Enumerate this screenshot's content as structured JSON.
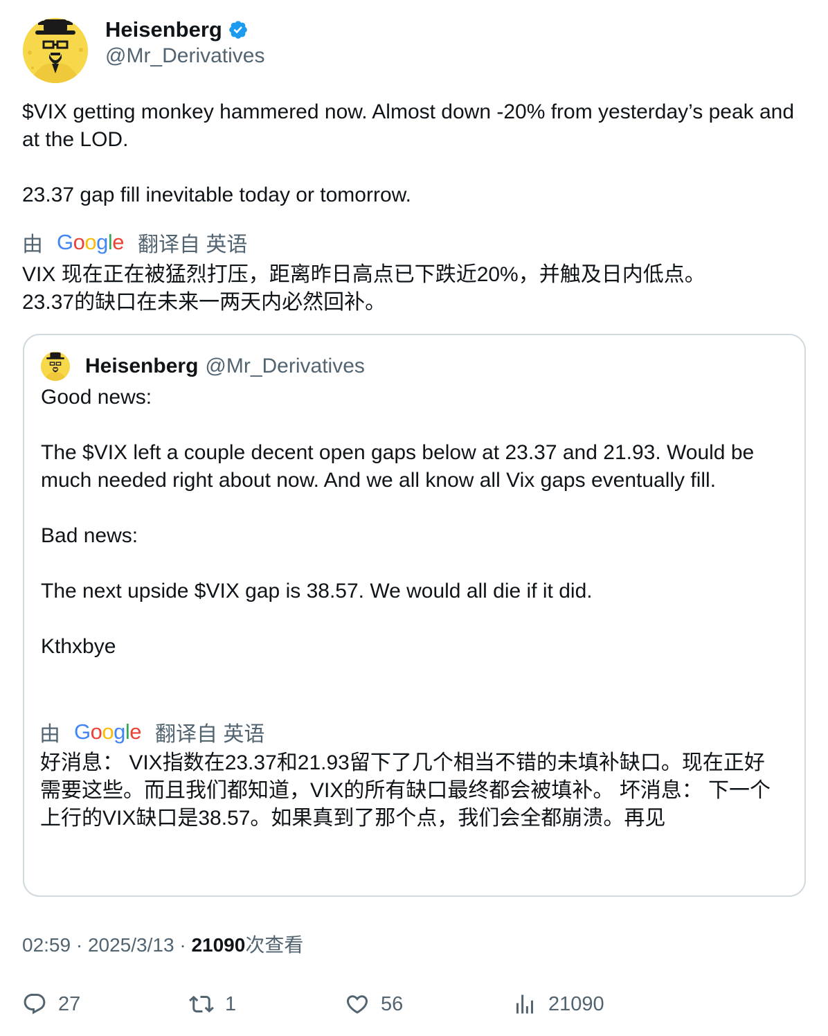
{
  "author": {
    "name": "Heisenberg",
    "handle": "@Mr_Derivatives",
    "verified": true
  },
  "tweet": {
    "text": "$VIX getting monkey hammered now. Almost down -20% from yesterday’s peak and at the LOD.\n\n23.37 gap fill inevitable today or tomorrow.",
    "translation_prefix": "由",
    "translation_provider": "Google",
    "translation_suffix": "翻译自 英语",
    "translated_text": "VIX 现在正在被猛烈打压，距离昨日高点已下跌近20%，并触及日内低点。\n23.37的缺口在未来一两天内必然回补。"
  },
  "quoted": {
    "name": "Heisenberg",
    "handle": "@Mr_Derivatives",
    "text": "Good news:\n\nThe $VIX left a couple decent open gaps below at 23.37 and 21.93. Would be much needed right about now. And we all know all Vix gaps eventually fill.\n\nBad news:\n\nThe next upside $VIX gap is 38.57. We would all die if it did.\n\nKthxbye",
    "translation_prefix": "由",
    "translation_provider": "Google",
    "translation_suffix": "翻译自 英语",
    "translated_text": "好消息： VIX指数在23.37和21.93留下了几个相当不错的未填补缺口。现在正好需要这些。而且我们都知道，VIX的所有缺口最终都会被填补。 坏消息： 下一个上行的VIX缺口是38.57。如果真到了那个点，我们会全都崩溃。再见"
  },
  "meta": {
    "time": "02:59",
    "separator": "·",
    "date": "2025/3/13",
    "views": "21090",
    "views_label": "次查看"
  },
  "actions": {
    "replies": "27",
    "reposts": "1",
    "likes": "56",
    "views": "21090"
  },
  "colors": {
    "text": "#0f1419",
    "secondary": "#536471",
    "border": "#cfd9de",
    "verified": "#1d9bf0",
    "avatar_bg": "#f7d84a"
  },
  "icons": [
    "verified-badge-icon",
    "reply-icon",
    "repost-icon",
    "like-icon",
    "views-icon"
  ]
}
